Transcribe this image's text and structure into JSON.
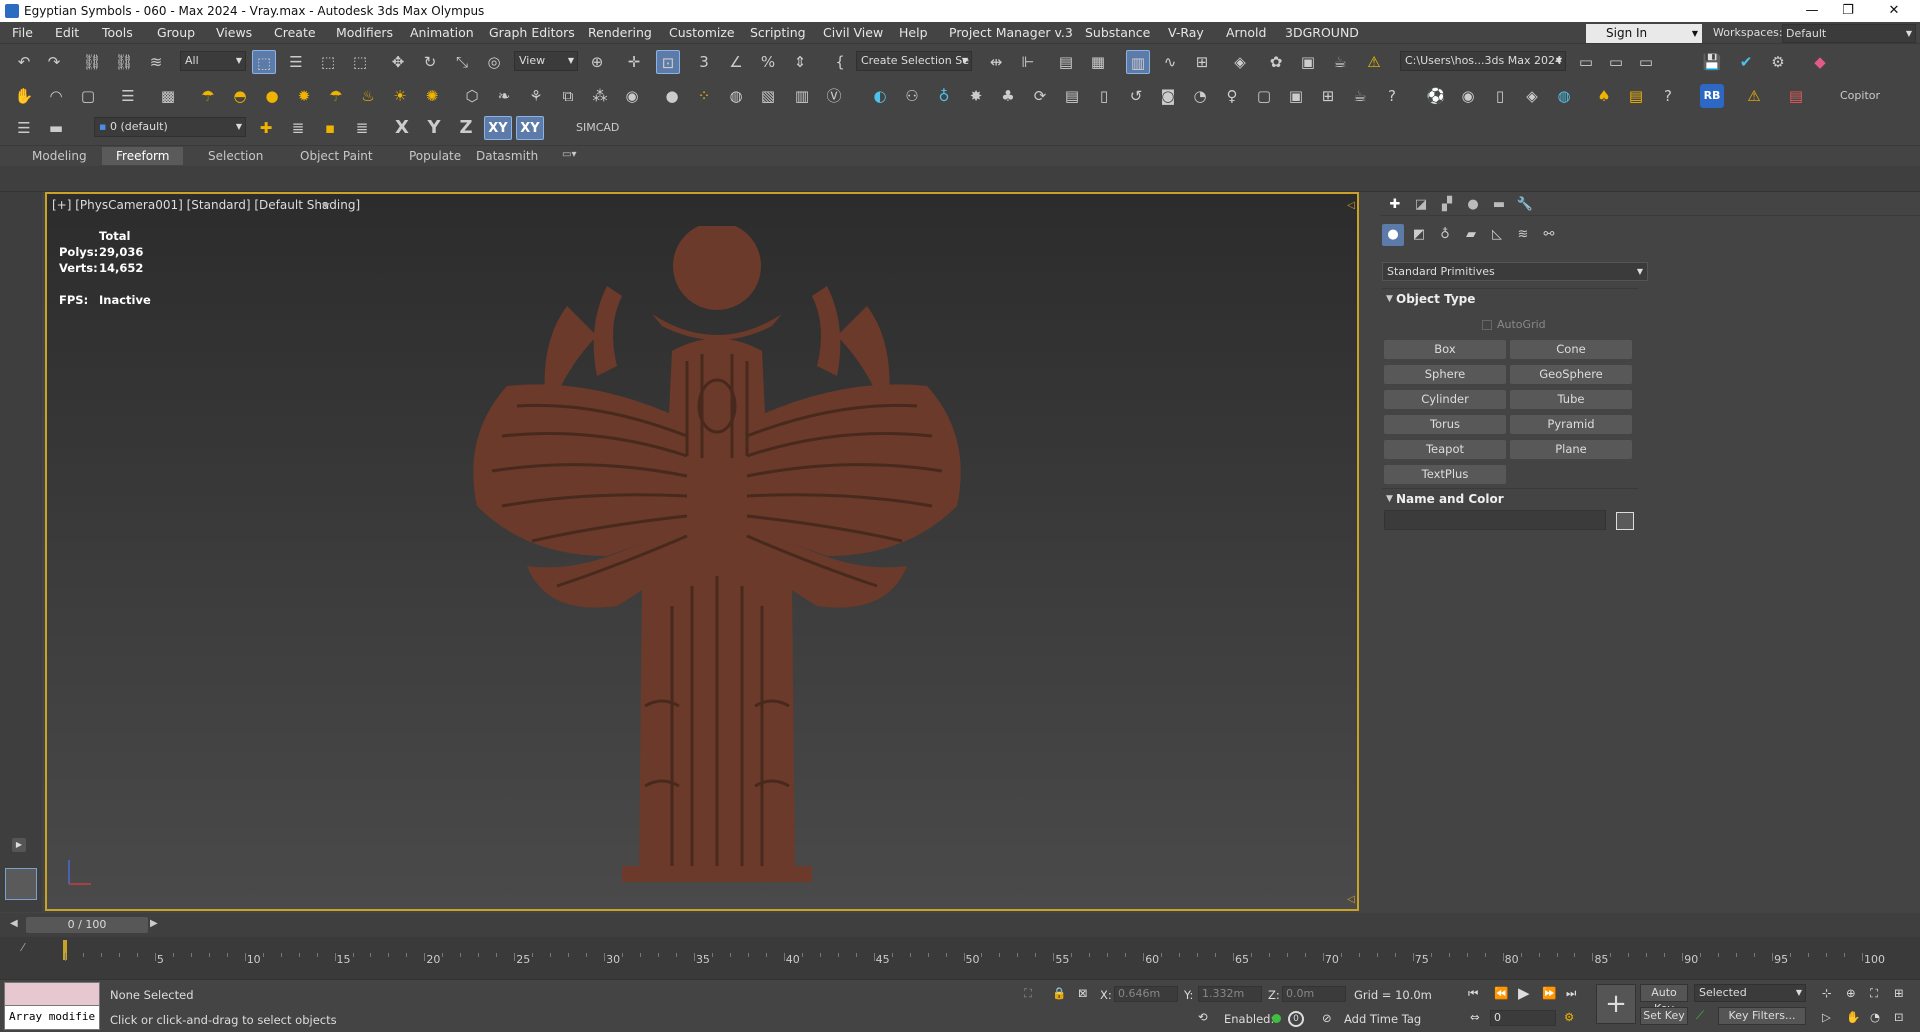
{
  "window": {
    "title": "Egyptian Symbols - 060 - Max 2024 - Vray.max - Autodesk 3ds Max Olympus",
    "minimize": "—",
    "maximize": "❐",
    "close": "✕"
  },
  "menubar": {
    "items": [
      "File",
      "Edit",
      "Tools",
      "Group",
      "Views",
      "Create",
      "Modifiers",
      "Animation",
      "Graph Editors",
      "Rendering",
      "Customize",
      "Scripting",
      "Civil View",
      "Help",
      "Project Manager v.3",
      "Substance",
      "V-Ray",
      "Arnold",
      "3DGROUND"
    ],
    "sign_in": "Sign In",
    "workspaces_label": "Workspaces:",
    "workspace": "Default"
  },
  "toolbar": {
    "selection_filter": "All",
    "ref_coord": "View",
    "named_selection": "Create Selection Se",
    "project_path": "C:\\Users\\hos...3ds Max 2024",
    "copitor_label": "Copitor",
    "layer": "0 (default)",
    "axis_x": "X",
    "axis_y": "Y",
    "axis_z": "Z",
    "axis_xy": "XY",
    "axis_xy2": "XY",
    "simcad": "SIMCAD"
  },
  "ribbon": {
    "tabs": [
      "Modeling",
      "Freeform",
      "Selection",
      "Object Paint",
      "Populate",
      "Datasmith"
    ],
    "active_tab": "Freeform"
  },
  "viewport": {
    "label": "[+] [PhysCamera001] [Standard] [Default Shading]",
    "stats": {
      "header": "Total",
      "polys_label": "Polys:",
      "polys": "29,036",
      "verts_label": "Verts:",
      "verts": "14,652",
      "fps_label": "FPS:",
      "fps": "Inactive"
    },
    "model_color": "#6b3a2a"
  },
  "command_panel": {
    "category_dropdown": "Standard Primitives",
    "object_type_title": "Object Type",
    "autogrid": "AutoGrid",
    "primitives": [
      "Box",
      "Cone",
      "Sphere",
      "GeoSphere",
      "Cylinder",
      "Tube",
      "Torus",
      "Pyramid",
      "Teapot",
      "Plane",
      "TextPlus"
    ],
    "name_color_title": "Name and Color"
  },
  "timeline": {
    "frame_indicator": "0 / 100",
    "ticks": [
      "5",
      "10",
      "15",
      "20",
      "25",
      "30",
      "35",
      "40",
      "45",
      "50",
      "55",
      "60",
      "65",
      "70",
      "75",
      "80",
      "85",
      "90",
      "95",
      "100"
    ]
  },
  "status": {
    "maxscript_value": "Array modifie",
    "selection": "None Selected",
    "prompt": "Click or click-and-drag to select objects",
    "x_label": "X:",
    "x_value": "0.646m",
    "y_label": "Y:",
    "y_value": "1.332m",
    "z_label": "Z:",
    "z_value": "0.0m",
    "grid": "Grid = 10.0m",
    "enabled_label": "Enabled:",
    "add_time_tag": "Add Time Tag",
    "frame_value": "0",
    "auto_key": "Auto Key",
    "set_key": "Set Key",
    "key_mode": "Selected",
    "key_filters": "Key Filters..."
  }
}
